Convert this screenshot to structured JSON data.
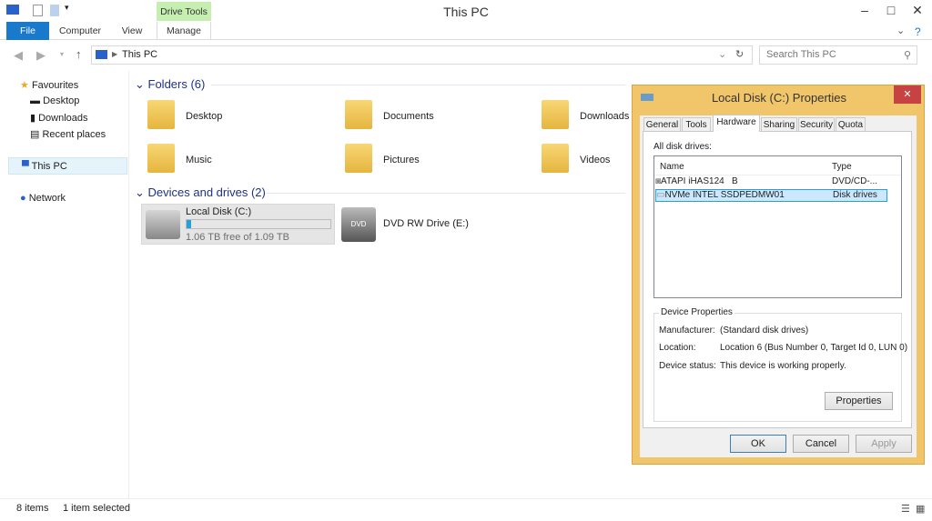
{
  "window": {
    "title": "This PC",
    "context_tab": "Drive Tools"
  },
  "ribbon": {
    "tabs": [
      "File",
      "Computer",
      "View",
      "Manage"
    ]
  },
  "address": {
    "path": "This PC",
    "search_placeholder": "Search This PC"
  },
  "nav": {
    "items": [
      "Favourites",
      "Desktop",
      "Downloads",
      "Recent places",
      "This PC",
      "Network"
    ]
  },
  "folders": {
    "header": "Folders (6)",
    "items": [
      "Desktop",
      "Documents",
      "Downloads",
      "Music",
      "Pictures",
      "Videos"
    ]
  },
  "drives": {
    "header": "Devices and drives (2)",
    "items": [
      {
        "name": "Local Disk (C:)",
        "free": "1.06 TB free of 1.09 TB",
        "used_fraction": 0.03
      },
      {
        "name": "DVD RW Drive (E:)"
      }
    ]
  },
  "status": {
    "count": "8 items",
    "selected": "1 item selected"
  },
  "dialog": {
    "title": "Local Disk (C:) Properties",
    "tabs": [
      "General",
      "Tools",
      "Hardware",
      "Sharing",
      "Security",
      "Quota"
    ],
    "all_drives_label": "All disk drives:",
    "columns": [
      "Name",
      "Type"
    ],
    "rows": [
      {
        "name": "ATAPI iHAS124   B",
        "type": "DVD/CD-..."
      },
      {
        "name": "NVMe INTEL SSDPEDMW01",
        "type": "Disk drives"
      }
    ],
    "group": "Device Properties",
    "manufacturer_label": "Manufacturer:",
    "manufacturer": "(Standard disk drives)",
    "location_label": "Location:",
    "location": "Location 6 (Bus Number 0, Target Id 0, LUN 0)",
    "status_label": "Device status:",
    "status": "This device is working properly.",
    "properties_btn": "Properties",
    "ok": "OK",
    "cancel": "Cancel",
    "apply": "Apply"
  },
  "colors": {
    "accent": "#1979ca",
    "dialog_frame": "#f1c66a",
    "section": "#1e3287",
    "close": "#c74343"
  }
}
